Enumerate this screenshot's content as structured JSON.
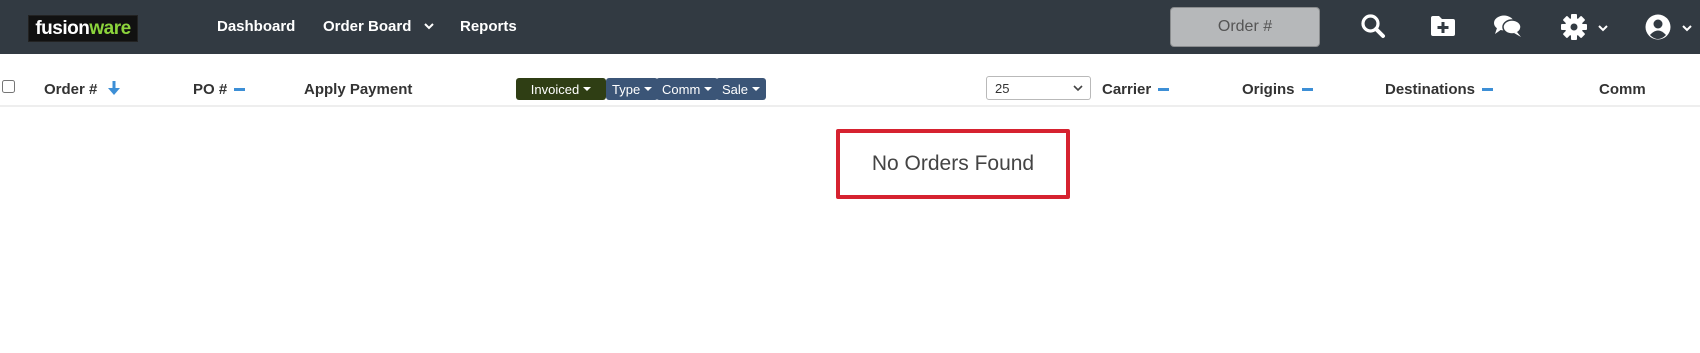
{
  "brand": {
    "part1": "fusion",
    "part2": "ware"
  },
  "nav": {
    "dashboard": "Dashboard",
    "order_board": "Order Board",
    "reports": "Reports"
  },
  "search": {
    "placeholder": "Order #"
  },
  "top_icons": [
    "search-icon",
    "folder-plus-icon",
    "chat-icon",
    "gear-icon",
    "user-circle-icon"
  ],
  "table_header": {
    "order": "Order #",
    "po": "PO #",
    "apply_payment": "Apply Payment",
    "filters": {
      "invoiced": "Invoiced",
      "type": "Type",
      "comm": "Comm",
      "sale": "Sale"
    },
    "page_size": "25",
    "carrier": "Carrier",
    "origins": "Origins",
    "destinations": "Destinations",
    "comm": "Comm"
  },
  "empty_state": "No Orders Found",
  "colors": {
    "topbar": "#323a42",
    "invoiced_pill": "#2f3e14",
    "filter_pill": "#3b5577",
    "accent": "#3d8fd6",
    "highlight_border": "#d62230"
  }
}
